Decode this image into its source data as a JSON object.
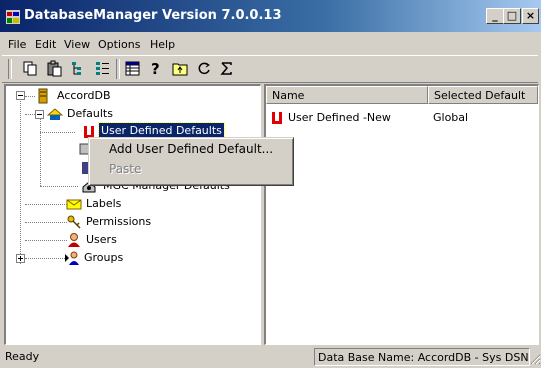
{
  "window": {
    "title": "DatabaseManager Version 7.0.0.13"
  },
  "caption_buttons": {
    "minimize": "_",
    "maximize": "□",
    "close": "×"
  },
  "menu": [
    "File",
    "Edit",
    "View",
    "Options",
    "Help"
  ],
  "toolbar": [
    "copy-icon",
    "paste-icon",
    "tree-view-icon",
    "details-view-icon",
    "grid-view-icon",
    "help-icon",
    "up-folder-icon",
    "refresh-icon",
    "sigma-icon"
  ],
  "tree": {
    "root": "AccordDB",
    "defaults": "Defaults",
    "user_defined": "User Defined Defaults",
    "mgc_manager": "MGC Manager Defaults",
    "labels": "Labels",
    "permissions": "Permissions",
    "users": "Users",
    "groups": "Groups"
  },
  "list": {
    "columns": [
      "Name",
      "Selected Default"
    ],
    "rows": [
      {
        "name": "User Defined -New",
        "selected_default": "Global"
      }
    ]
  },
  "context_menu": {
    "add": "Add User Defined Default...",
    "paste": "Paste"
  },
  "status": {
    "left": "Ready",
    "right": "Data Base Name: AccordDB - Sys DSN"
  },
  "colors": {
    "titlebar": "#0a246a",
    "face": "#d4d0c8",
    "selection": "#0a246a"
  }
}
